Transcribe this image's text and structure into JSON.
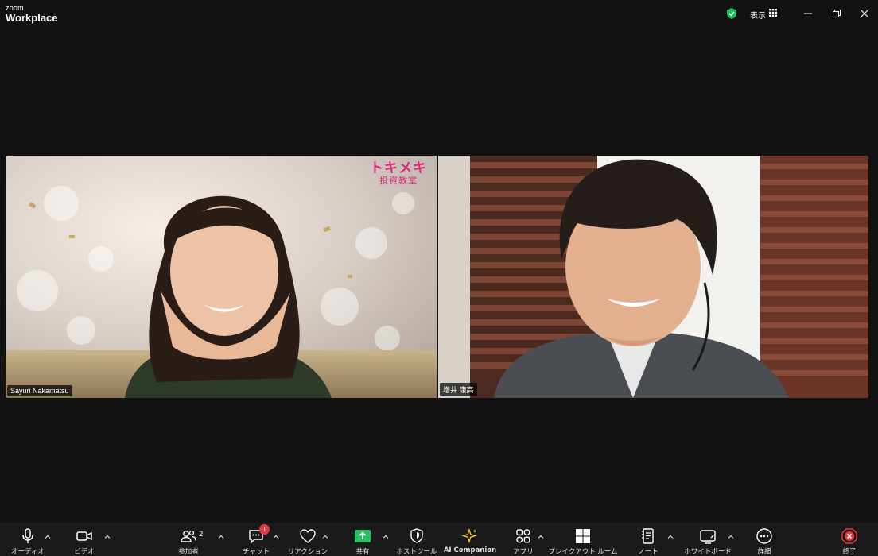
{
  "app": {
    "brand_small": "zoom",
    "brand_big": "Workplace"
  },
  "titlebar": {
    "view_label": "表示"
  },
  "participants": [
    {
      "name": "Sayuri Nakamatsu"
    },
    {
      "name": "増井 康高"
    }
  ],
  "background_logo": {
    "main": "トキメキ",
    "sub": "投資教室"
  },
  "toolbar": {
    "audio": "オーディオ",
    "video": "ビデオ",
    "participants": "参加者",
    "participants_count": "2",
    "chat": "チャット",
    "chat_badge": "1",
    "reactions": "リアクション",
    "share": "共有",
    "host_tools": "ホストツール",
    "ai_companion": "AI Companion",
    "apps": "アプリ",
    "breakout": "ブレイクアウト ルーム",
    "notes": "ノート",
    "whiteboard": "ホワイトボード",
    "more": "詳細",
    "end": "終了"
  },
  "colors": {
    "share_green": "#23c35f",
    "end_red": "#e8363d",
    "shield_green": "#1fbf5c",
    "logo_pink": "#e0287a"
  }
}
